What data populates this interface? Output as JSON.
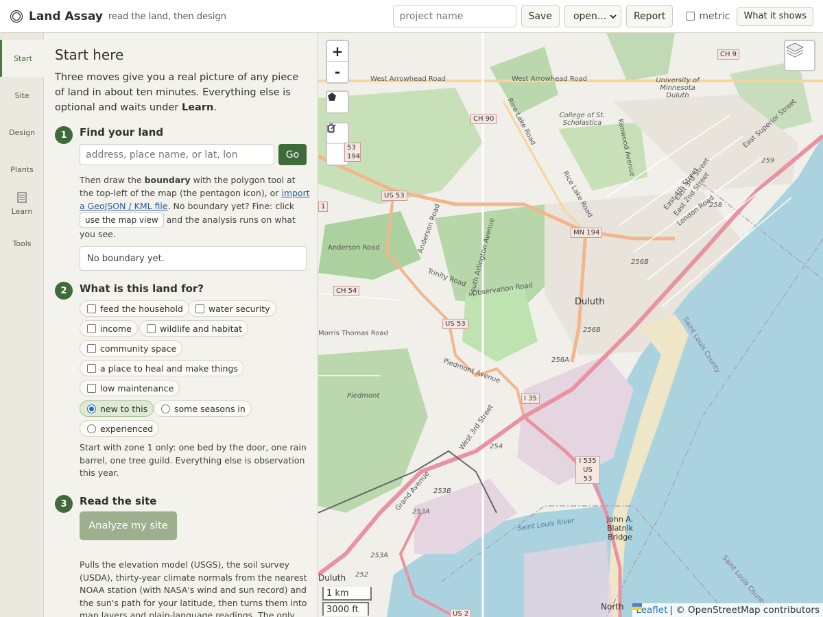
{
  "header": {
    "app_name": "Land Assay",
    "tagline": "read the land, then design",
    "project_placeholder": "project name",
    "save": "Save",
    "open_select": "open...",
    "report": "Report",
    "metric_label": "metric",
    "what_it_shows": "What it shows"
  },
  "rail": {
    "items": [
      {
        "label": "Start"
      },
      {
        "label": "Site"
      },
      {
        "label": "Design"
      },
      {
        "label": "Plants"
      },
      {
        "label": "Learn"
      },
      {
        "label": "Tools"
      }
    ]
  },
  "panel": {
    "title": "Start here",
    "intro_before": "Three moves give you a real picture of any piece of land in about ten minutes. Everything else is optional and waits under ",
    "intro_bold": "Learn",
    "intro_after": ".",
    "step1": {
      "number": "1",
      "title": "Find your land",
      "address_placeholder": "address, place name, or lat, lon",
      "go": "Go",
      "help_1": "Then draw the ",
      "help_bold": "boundary",
      "help_2": " with the polygon tool at the top-left of the map (the pentagon icon), or ",
      "help_link": "import a GeoJSON / KML file",
      "help_3": ". No boundary yet? Fine: click ",
      "use_map_view": "use the map view",
      "help_4": " and the analysis runs on what you see.",
      "status": "No boundary yet."
    },
    "step2": {
      "number": "2",
      "title": "What is this land for?",
      "goals": [
        {
          "label": "feed the household"
        },
        {
          "label": "water security"
        },
        {
          "label": "income"
        },
        {
          "label": "wildlife and habitat"
        },
        {
          "label": "community space"
        },
        {
          "label": "a place to heal and make things"
        },
        {
          "label": "low maintenance"
        }
      ],
      "experience": [
        {
          "label": "new to this",
          "selected": true
        },
        {
          "label": "some seasons in",
          "selected": false
        },
        {
          "label": "experienced",
          "selected": false
        }
      ],
      "note": "Start with zone 1 only: one bed by the door, one rain barrel, one tree guild. Everything else is observation this year."
    },
    "step3": {
      "number": "3",
      "title": "Read the site",
      "analyze": "Analyze my site",
      "description": "Pulls the elevation model (USGS), the soil survey (USDA), thirty-year climate normals from the nearest NOAA station (with NASA's wind and sun record) and the sun's path for your latitude, then turns them into map layers and plain-language readings. The only"
    }
  },
  "map": {
    "zoom_in": "+",
    "zoom_out": "-",
    "labels": {
      "duluth": "Duluth",
      "duluth_sw": "Duluth",
      "north": "North",
      "college": "College of St. Scholastica",
      "umd": "University of Minnesota Duluth",
      "blatnik": "John A. Blatnik Bridge",
      "piedmont": "Piedmont",
      "stlouis_river": "Saint Louis River",
      "stlouis_county": "Saint Louis County",
      "stlouis_county2": "Saint Louis County",
      "w_arrowhead": "West Arrowhead Road",
      "w_arrowhead2": "West Arrowhead Road",
      "anderson": "Anderson Road",
      "morris": "Morris Thomas Road",
      "trinity": "Trinity Road",
      "observation": "Observation Road",
      "piedmont_ave": "Piedmont Avenue",
      "w3rd": "West 3rd Street",
      "grand": "Grand Avenue",
      "rice_lake": "Rice Lake Road",
      "rice_lake2": "Rice Lake Road",
      "anderson_rd2": "Anderson Road",
      "arlington": "South Arlington Avenue",
      "kenwood": "Kenwood Avenue",
      "e_superior": "East Superior Street",
      "london": "London Road",
      "e4th": "East 4th Street",
      "e3rd": "East 3rd Street",
      "e2nd": "East 2nd Street"
    },
    "shields": {
      "ch9": "CH 9",
      "ch90": "CH 90",
      "ch54": "CH 54",
      "us53a": "US 53",
      "us53b": "US 53",
      "mn194": "MN 194",
      "i35": "I 35",
      "i535": "I 535 US 53",
      "us2": "US 2",
      "s53_194": "53 194",
      "s1": "1"
    },
    "exits": {
      "e259": "259",
      "e258": "258",
      "e256b": "256B",
      "e256b2": "256B",
      "e256a": "256A",
      "e254": "254",
      "e253b": "253B",
      "e253a": "253A",
      "e253a2": "253A",
      "e252": "252"
    },
    "scale_km": "1 km",
    "scale_ft": "3000 ft",
    "attribution_leaflet": "Leaflet",
    "attribution_rest": "| © OpenStreetMap contributors"
  },
  "colors": {
    "accent": "#3f6a3a",
    "water": "#aad3df",
    "forest": "#add19e",
    "industrial": "#e5d5e1",
    "highway": "#e892a2"
  }
}
